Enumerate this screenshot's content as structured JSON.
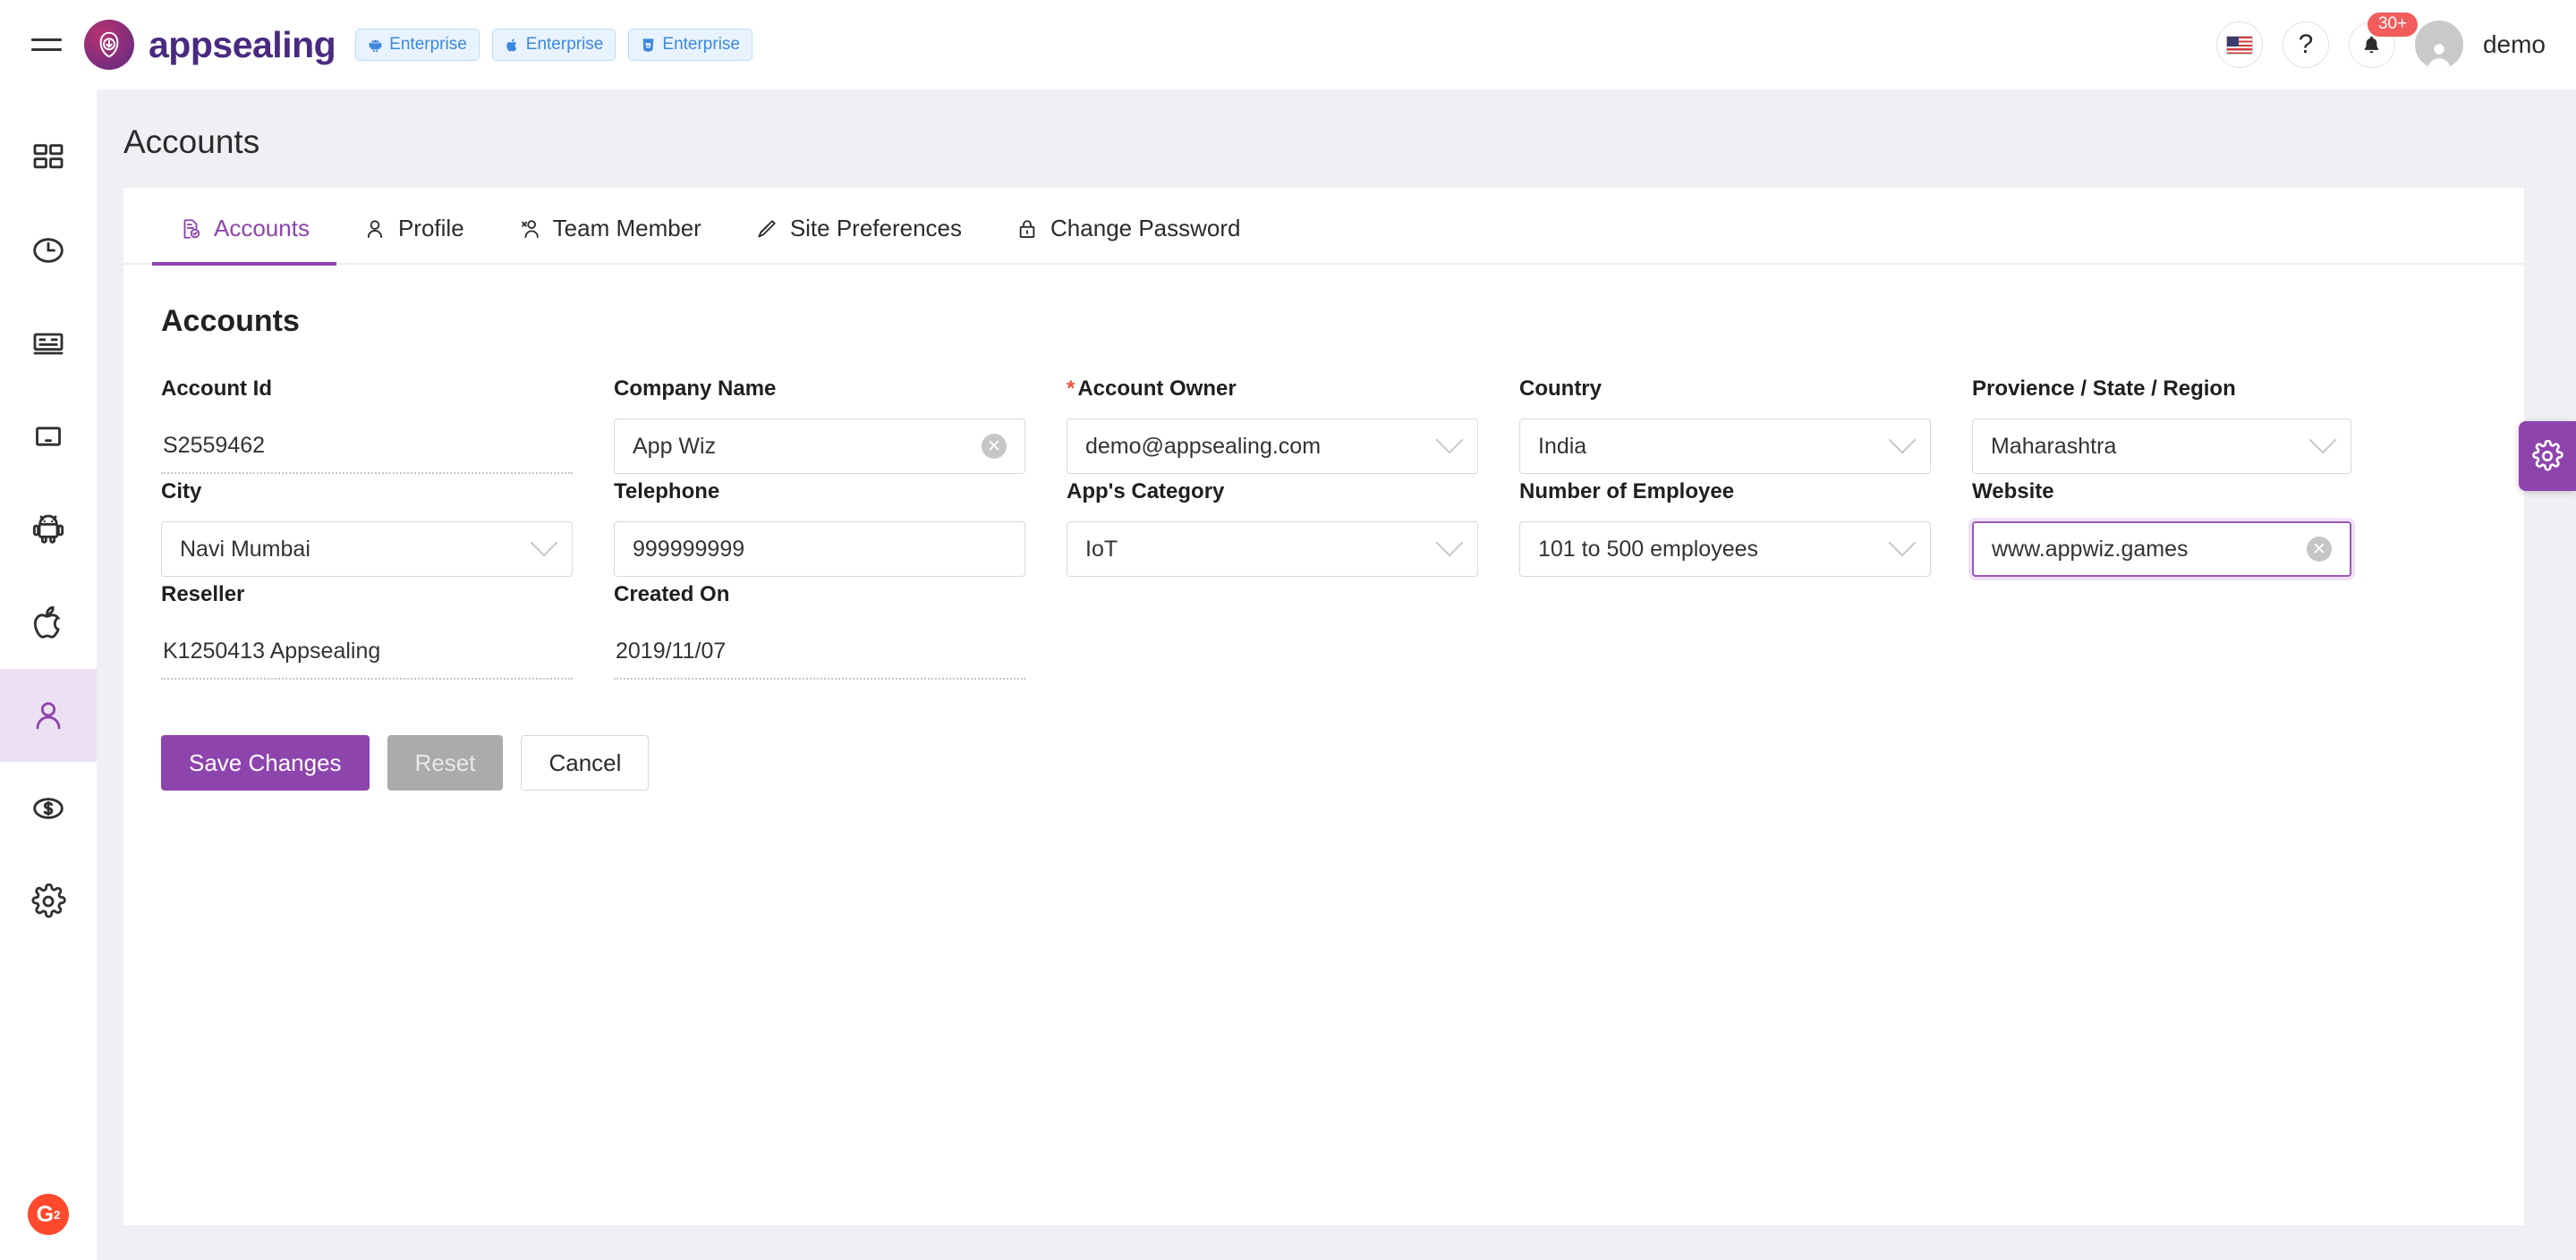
{
  "header": {
    "menu_icon": "hamburger-menu-icon",
    "brand_name": "appsealing",
    "badges": [
      {
        "icon": "android-icon",
        "label": "Enterprise"
      },
      {
        "icon": "apple-icon",
        "label": "Enterprise"
      },
      {
        "icon": "html5-icon",
        "label": "Enterprise"
      }
    ],
    "language_flag": "us-flag-icon",
    "help_icon": "question-mark-icon",
    "notifications": {
      "icon": "bell-icon",
      "count": "30+"
    },
    "avatar_icon": "user-avatar-icon",
    "username": "demo"
  },
  "sidebar": {
    "items": [
      {
        "name": "dashboard",
        "icon": "grid-dashboard-icon",
        "active": false
      },
      {
        "name": "history",
        "icon": "clock-icon",
        "active": false
      },
      {
        "name": "reports",
        "icon": "card-list-icon",
        "active": false
      },
      {
        "name": "devices",
        "icon": "tablet-icon",
        "active": false
      },
      {
        "name": "android",
        "icon": "android-icon",
        "active": false
      },
      {
        "name": "ios",
        "icon": "apple-icon",
        "active": false
      },
      {
        "name": "accounts",
        "icon": "user-icon",
        "active": true
      },
      {
        "name": "billing",
        "icon": "dollar-circle-icon",
        "active": false
      },
      {
        "name": "settings",
        "icon": "gear-icon",
        "active": false
      }
    ],
    "g2_badge": "G2"
  },
  "page": {
    "title": "Accounts",
    "section_title": "Accounts"
  },
  "tabs": [
    {
      "label": "Accounts",
      "icon": "document-check-icon",
      "active": true
    },
    {
      "label": "Profile",
      "icon": "user-icon",
      "active": false
    },
    {
      "label": "Team Member",
      "icon": "users-icon",
      "active": false
    },
    {
      "label": "Site Preferences",
      "icon": "pen-icon",
      "active": false
    },
    {
      "label": "Change Password",
      "icon": "lock-icon",
      "active": false
    }
  ],
  "form": {
    "fields": [
      {
        "label": "Account Id",
        "value": "S2559462",
        "type": "readonly",
        "required": false
      },
      {
        "label": "Company Name",
        "value": "App Wiz",
        "type": "text",
        "required": false,
        "clearable": true
      },
      {
        "label": "Account Owner",
        "value": "demo@appsealing.com",
        "type": "select",
        "required": true
      },
      {
        "label": "Country",
        "value": "India",
        "type": "select",
        "required": false
      },
      {
        "label": "Provience / State / Region",
        "value": "Maharashtra",
        "type": "select",
        "required": false
      },
      {
        "label": "City",
        "value": "Navi Mumbai",
        "type": "select",
        "required": false
      },
      {
        "label": "Telephone",
        "value": "999999999",
        "type": "text",
        "required": false
      },
      {
        "label": "App's Category",
        "value": "IoT",
        "type": "select",
        "required": false
      },
      {
        "label": "Number of Employee",
        "value": "101 to 500 employees",
        "type": "select",
        "required": false
      },
      {
        "label": "Website",
        "value": "www.appwiz.games",
        "type": "text",
        "required": false,
        "clearable": true,
        "focused": true
      },
      {
        "label": "Reseller",
        "value": "K1250413 Appsealing",
        "type": "readonly",
        "required": false
      },
      {
        "label": "Created On",
        "value": "2019/11/07",
        "type": "readonly",
        "required": false
      }
    ]
  },
  "actions": {
    "save_label": "Save Changes",
    "reset_label": "Reset",
    "cancel_label": "Cancel"
  },
  "floating": {
    "settings_icon": "gear-icon"
  },
  "colors": {
    "accent_purple": "#8e44ad",
    "badge_blue": "#3d88de",
    "notif_red": "#f15c5c",
    "required_red": "#f0543a",
    "g2_orange": "#ff492c"
  }
}
